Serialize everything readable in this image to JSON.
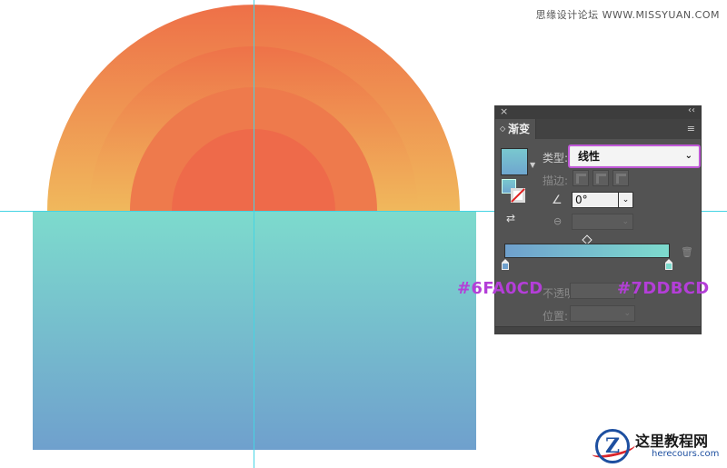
{
  "watermark": {
    "top_text": "思缘设计论坛 WWW.MISSYUAN.COM"
  },
  "logo": {
    "mark": "Z",
    "cn_text": "这里教程网",
    "en_text": "herecours.com"
  },
  "colors": {
    "sun_outer": [
      "#f0b85c",
      "#ee7048"
    ],
    "sun_inner": "#ee6a4a",
    "rect_top": "#7DDBCD",
    "rect_bottom": "#6FA0CD",
    "guide": "#45d4e4",
    "highlight": "#c058d8"
  },
  "panel": {
    "close_icon": "×",
    "collapse_icon": "‹‹",
    "tab_arrow": "◇",
    "tab_label": "渐变",
    "menu_icon": "≡",
    "type_label": "类型:",
    "type_value": "线性",
    "type_caret": "⌄",
    "stroke_label": "描边:",
    "angle_icon": "∠",
    "angle_value": "0°",
    "angle_caret": "⌄",
    "aspect_icon": "⊖",
    "aspect_caret": "⌄",
    "midpoint_icon": "◇",
    "trash_icon": "🗑",
    "opacity_label": "不透明度:",
    "position_label": "位置:",
    "position_caret": "⌄"
  },
  "annotations": {
    "left_stop_hex": "#6FA0CD",
    "right_stop_hex": "#7DDBCD"
  }
}
